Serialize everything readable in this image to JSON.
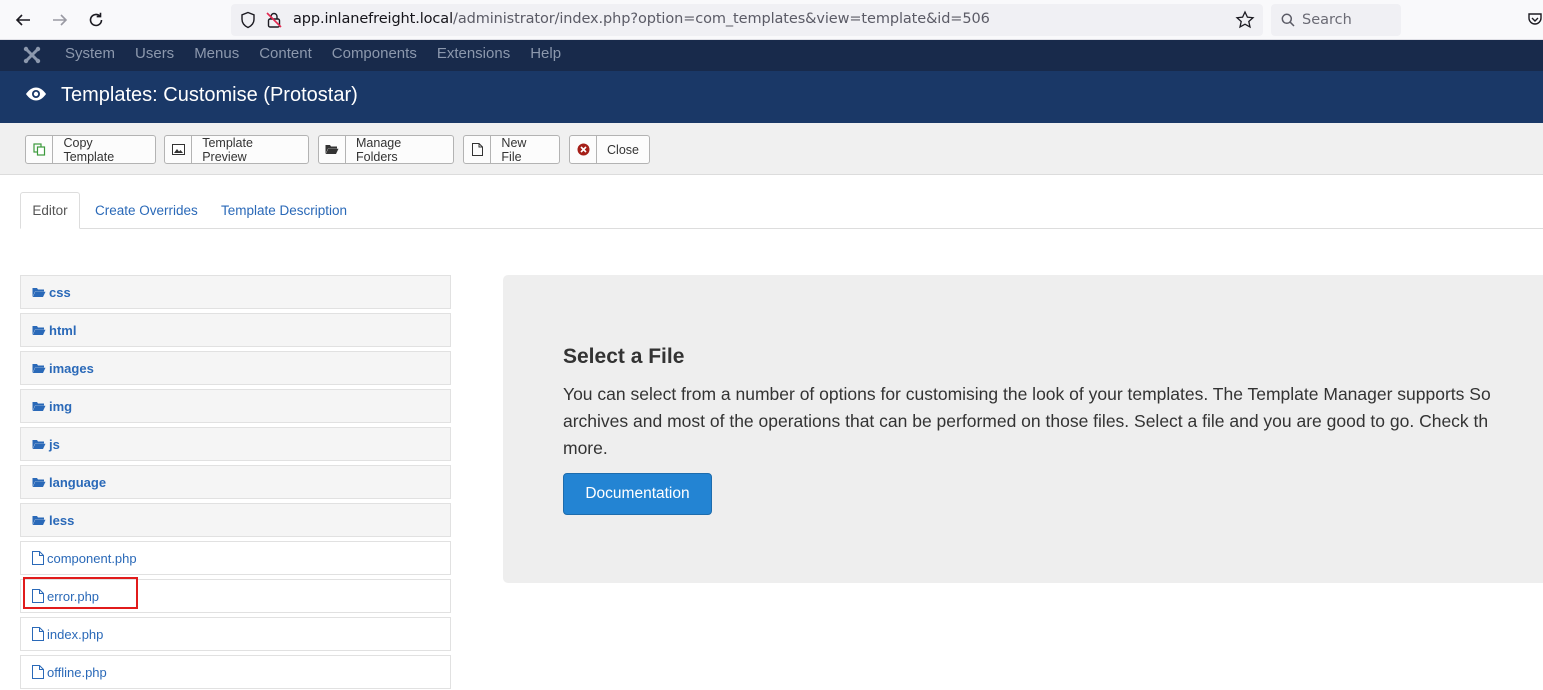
{
  "browser": {
    "url_domain": "app.inlanefreight.local",
    "url_path": "/administrator/index.php?option=com_templates&view=template&id=506",
    "search_placeholder": "Search"
  },
  "admin_nav": {
    "items": [
      "System",
      "Users",
      "Menus",
      "Content",
      "Components",
      "Extensions",
      "Help"
    ]
  },
  "header": {
    "title": "Templates: Customise (Protostar)"
  },
  "toolbar": {
    "copy_template": "Copy Template",
    "template_preview": "Template Preview",
    "manage_folders": "Manage Folders",
    "new_file": "New File",
    "close": "Close"
  },
  "tabs": {
    "editor": "Editor",
    "create_overrides": "Create Overrides",
    "template_description": "Template Description"
  },
  "file_tree": {
    "folders": [
      "css",
      "html",
      "images",
      "img",
      "js",
      "language",
      "less"
    ],
    "files": [
      "component.php",
      "error.php",
      "index.php",
      "offline.php"
    ]
  },
  "panel": {
    "title": "Select a File",
    "line1": "You can select from a number of options for customising the look of your templates. The Template Manager supports So",
    "line2": "archives and most of the operations that can be performed on those files. Select a file and you are good to go. Check th",
    "line3": "more.",
    "button": "Documentation"
  },
  "colors": {
    "admin_nav_bg": "#182a4b",
    "header_bg": "#1a3867",
    "link": "#2a69b8",
    "primary_button": "#2384d3",
    "highlight": "#e11b1b"
  }
}
